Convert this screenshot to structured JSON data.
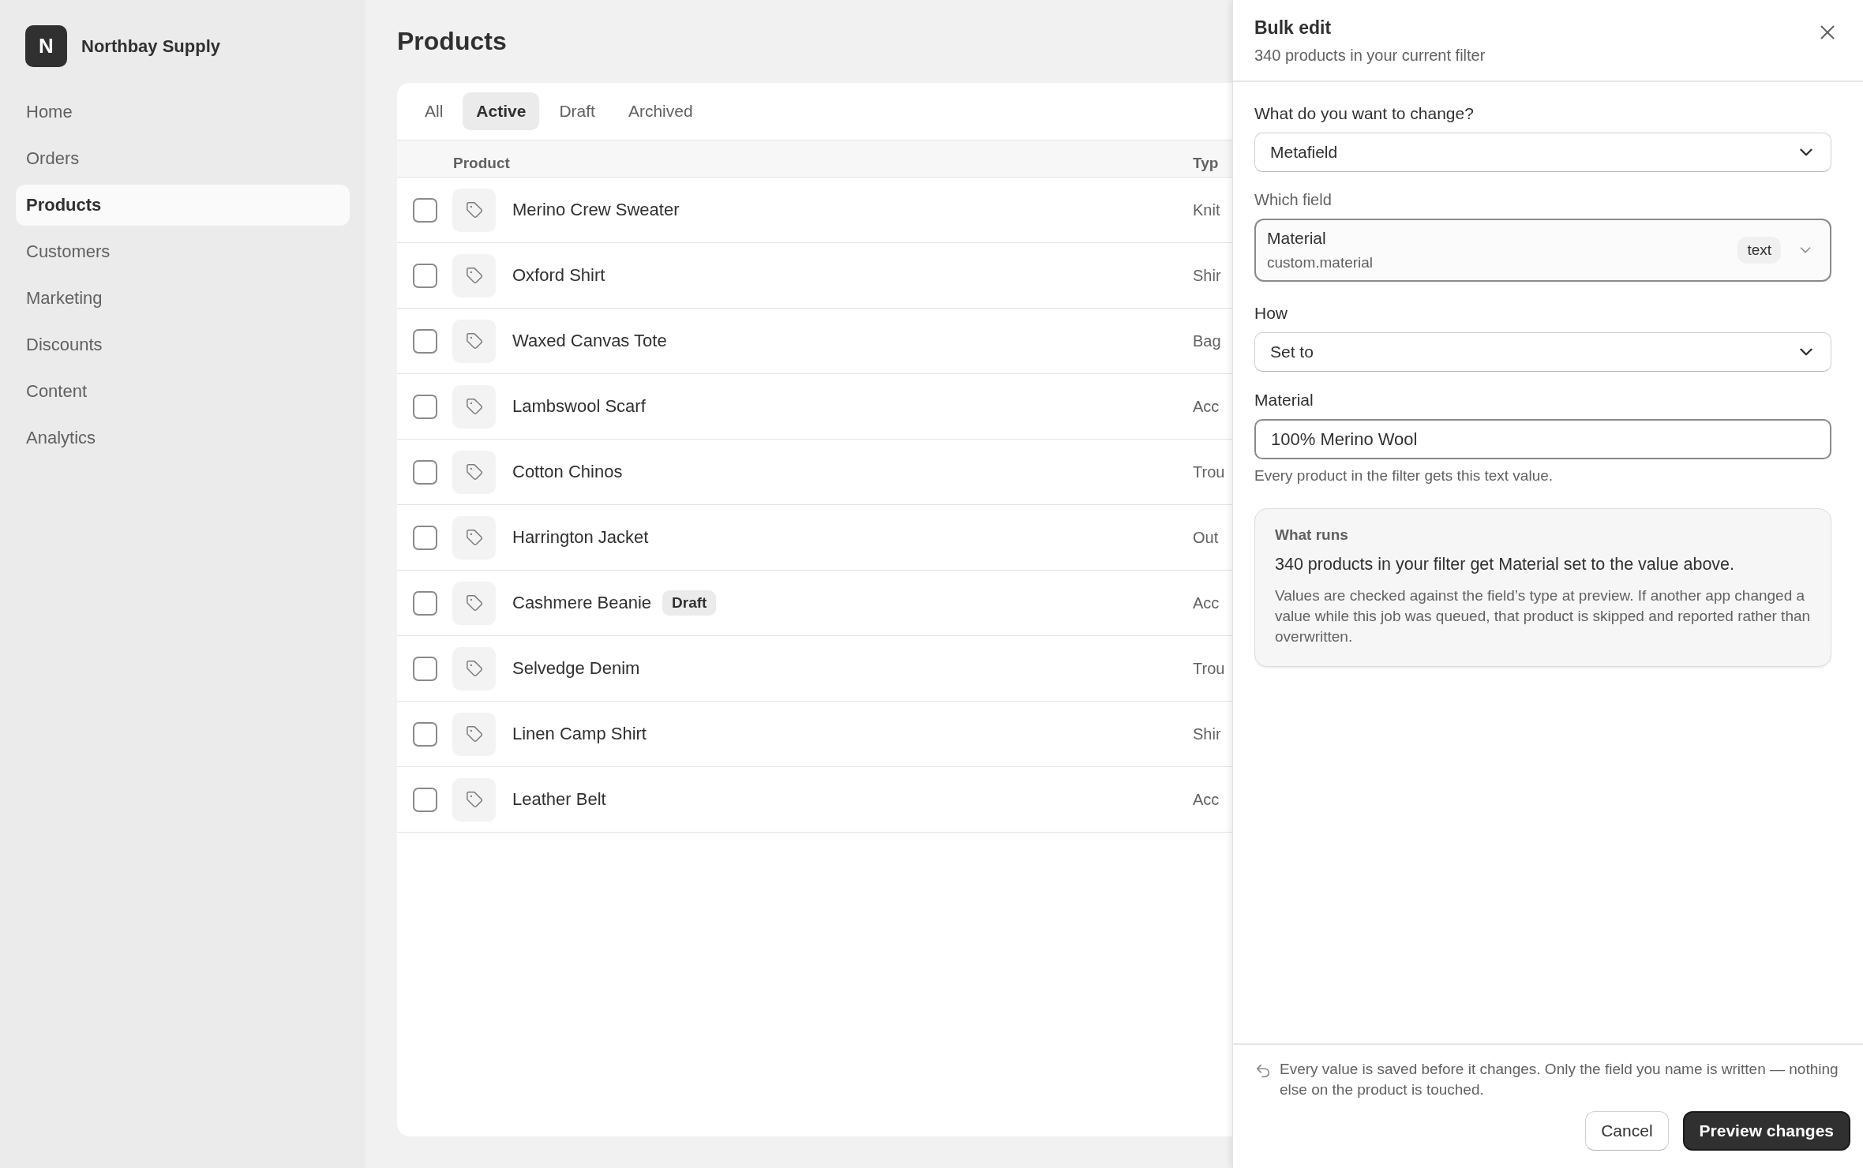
{
  "sidebar": {
    "brand": {
      "initial": "N",
      "name": "Northbay Supply"
    },
    "items": [
      {
        "label": "Home",
        "selected": false
      },
      {
        "label": "Orders",
        "selected": false
      },
      {
        "label": "Products",
        "selected": true
      },
      {
        "label": "Customers",
        "selected": false
      },
      {
        "label": "Marketing",
        "selected": false
      },
      {
        "label": "Discounts",
        "selected": false
      },
      {
        "label": "Content",
        "selected": false
      },
      {
        "label": "Analytics",
        "selected": false
      }
    ]
  },
  "page": {
    "title": "Products"
  },
  "tabs": [
    {
      "label": "All",
      "selected": false
    },
    {
      "label": "Active",
      "selected": true
    },
    {
      "label": "Draft",
      "selected": false
    },
    {
      "label": "Archived",
      "selected": false
    }
  ],
  "table": {
    "columns": [
      "Product",
      "Typ"
    ],
    "rows": [
      {
        "name": "Merino Crew Sweater",
        "type": "Knit",
        "checked": false
      },
      {
        "name": "Oxford Shirt",
        "type": "Shir",
        "checked": false
      },
      {
        "name": "Waxed Canvas Tote",
        "type": "Bag",
        "checked": false
      },
      {
        "name": "Lambswool Scarf",
        "type": "Acc",
        "checked": false
      },
      {
        "name": "Cotton Chinos",
        "type": "Trou",
        "checked": false
      },
      {
        "name": "Harrington Jacket",
        "type": "Out",
        "checked": false
      },
      {
        "name": "Cashmere Beanie",
        "badge": "Draft",
        "type": "Acc",
        "checked": false
      },
      {
        "name": "Selvedge Denim",
        "type": "Trou",
        "checked": false
      },
      {
        "name": "Linen Camp Shirt",
        "type": "Shir",
        "checked": false
      },
      {
        "name": "Leather Belt",
        "type": "Acc",
        "checked": false
      }
    ]
  },
  "bulk_edit": {
    "title": "Bulk edit",
    "subtitle": "340 products in your current filter",
    "change": {
      "label": "What do you want to change?",
      "value": "Metafield"
    },
    "which_field": {
      "label": "Which field",
      "name": "Material",
      "key": "custom.material",
      "type_badge": "text"
    },
    "how": {
      "label": "How",
      "value": "Set to"
    },
    "value_input": {
      "label": "Material",
      "value": "100% Merino Wool",
      "help": "Every product in the filter gets this text value."
    },
    "summary": {
      "heading": "What runs",
      "text": "340 products in your filter get Material set to the value above.",
      "note": "Values are checked against the field’s type at preview. If another app changed a value while this job was queued, that product is skipped and reported rather than overwritten."
    },
    "footer": {
      "note": "Every value is saved before it changes. Only the field you name is written — nothing else on the product is touched.",
      "buttons": [
        {
          "label": "Cancel",
          "kind": "secondary"
        },
        {
          "label": "Preview changes",
          "kind": "primary"
        }
      ]
    }
  }
}
